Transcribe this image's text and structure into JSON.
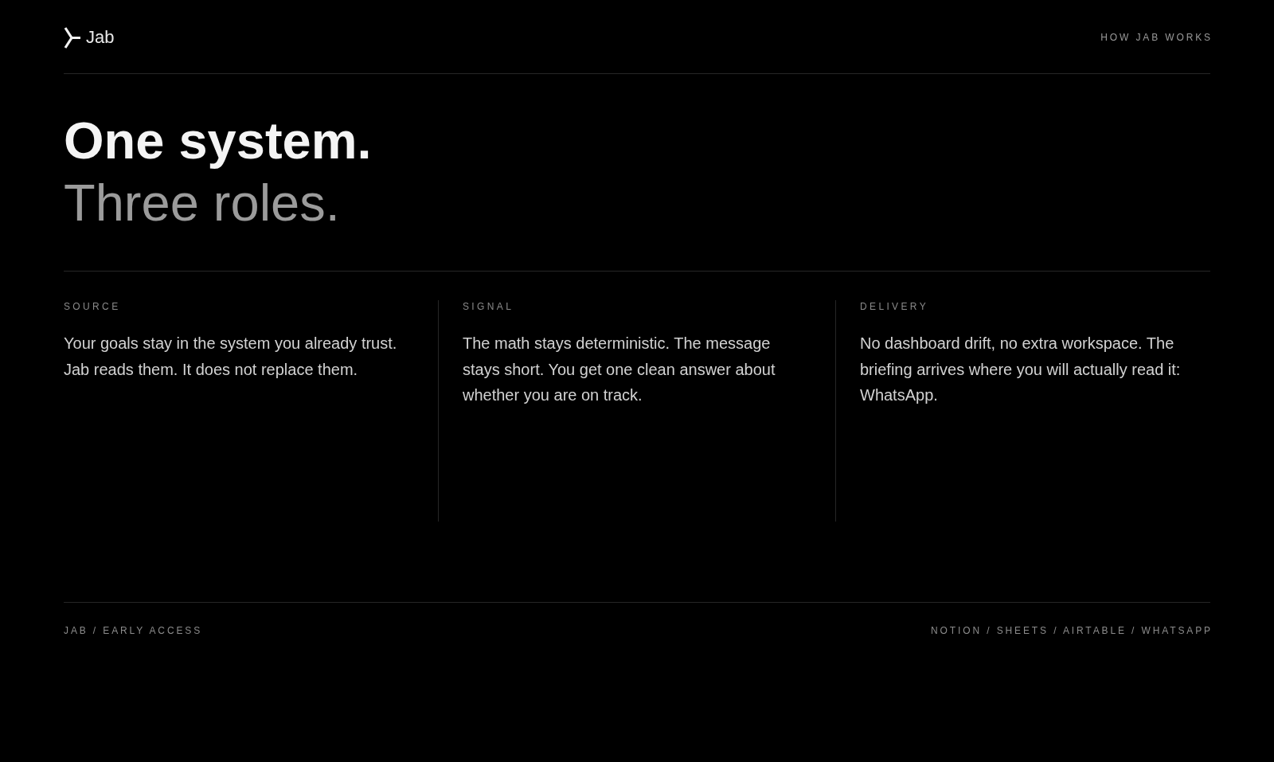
{
  "header": {
    "logo": {
      "text": "Jab"
    },
    "nav_links": [
      {
        "label": "HOW JAB WORKS"
      }
    ]
  },
  "hero": {
    "title_lines": [
      {
        "text": "One system.",
        "kind": "primary"
      },
      {
        "text": "Three roles.",
        "kind": "secondary"
      }
    ]
  },
  "roles": [
    {
      "label": "SOURCE",
      "text": "Your goals stay in the system you already trust. Jab reads them. It does not replace them."
    },
    {
      "label": "SIGNAL",
      "text": "The math stays deterministic. The message stays short. You get one clean answer about whether you are on track."
    },
    {
      "label": "DELIVERY",
      "text": "No dashboard drift, no extra workspace. The briefing arrives where you will actually read it: WhatsApp."
    }
  ],
  "footer": {
    "left": "JAB / EARLY ACCESS",
    "right": "NOTION / SHEETS / AIRTABLE / WHATSAPP"
  }
}
